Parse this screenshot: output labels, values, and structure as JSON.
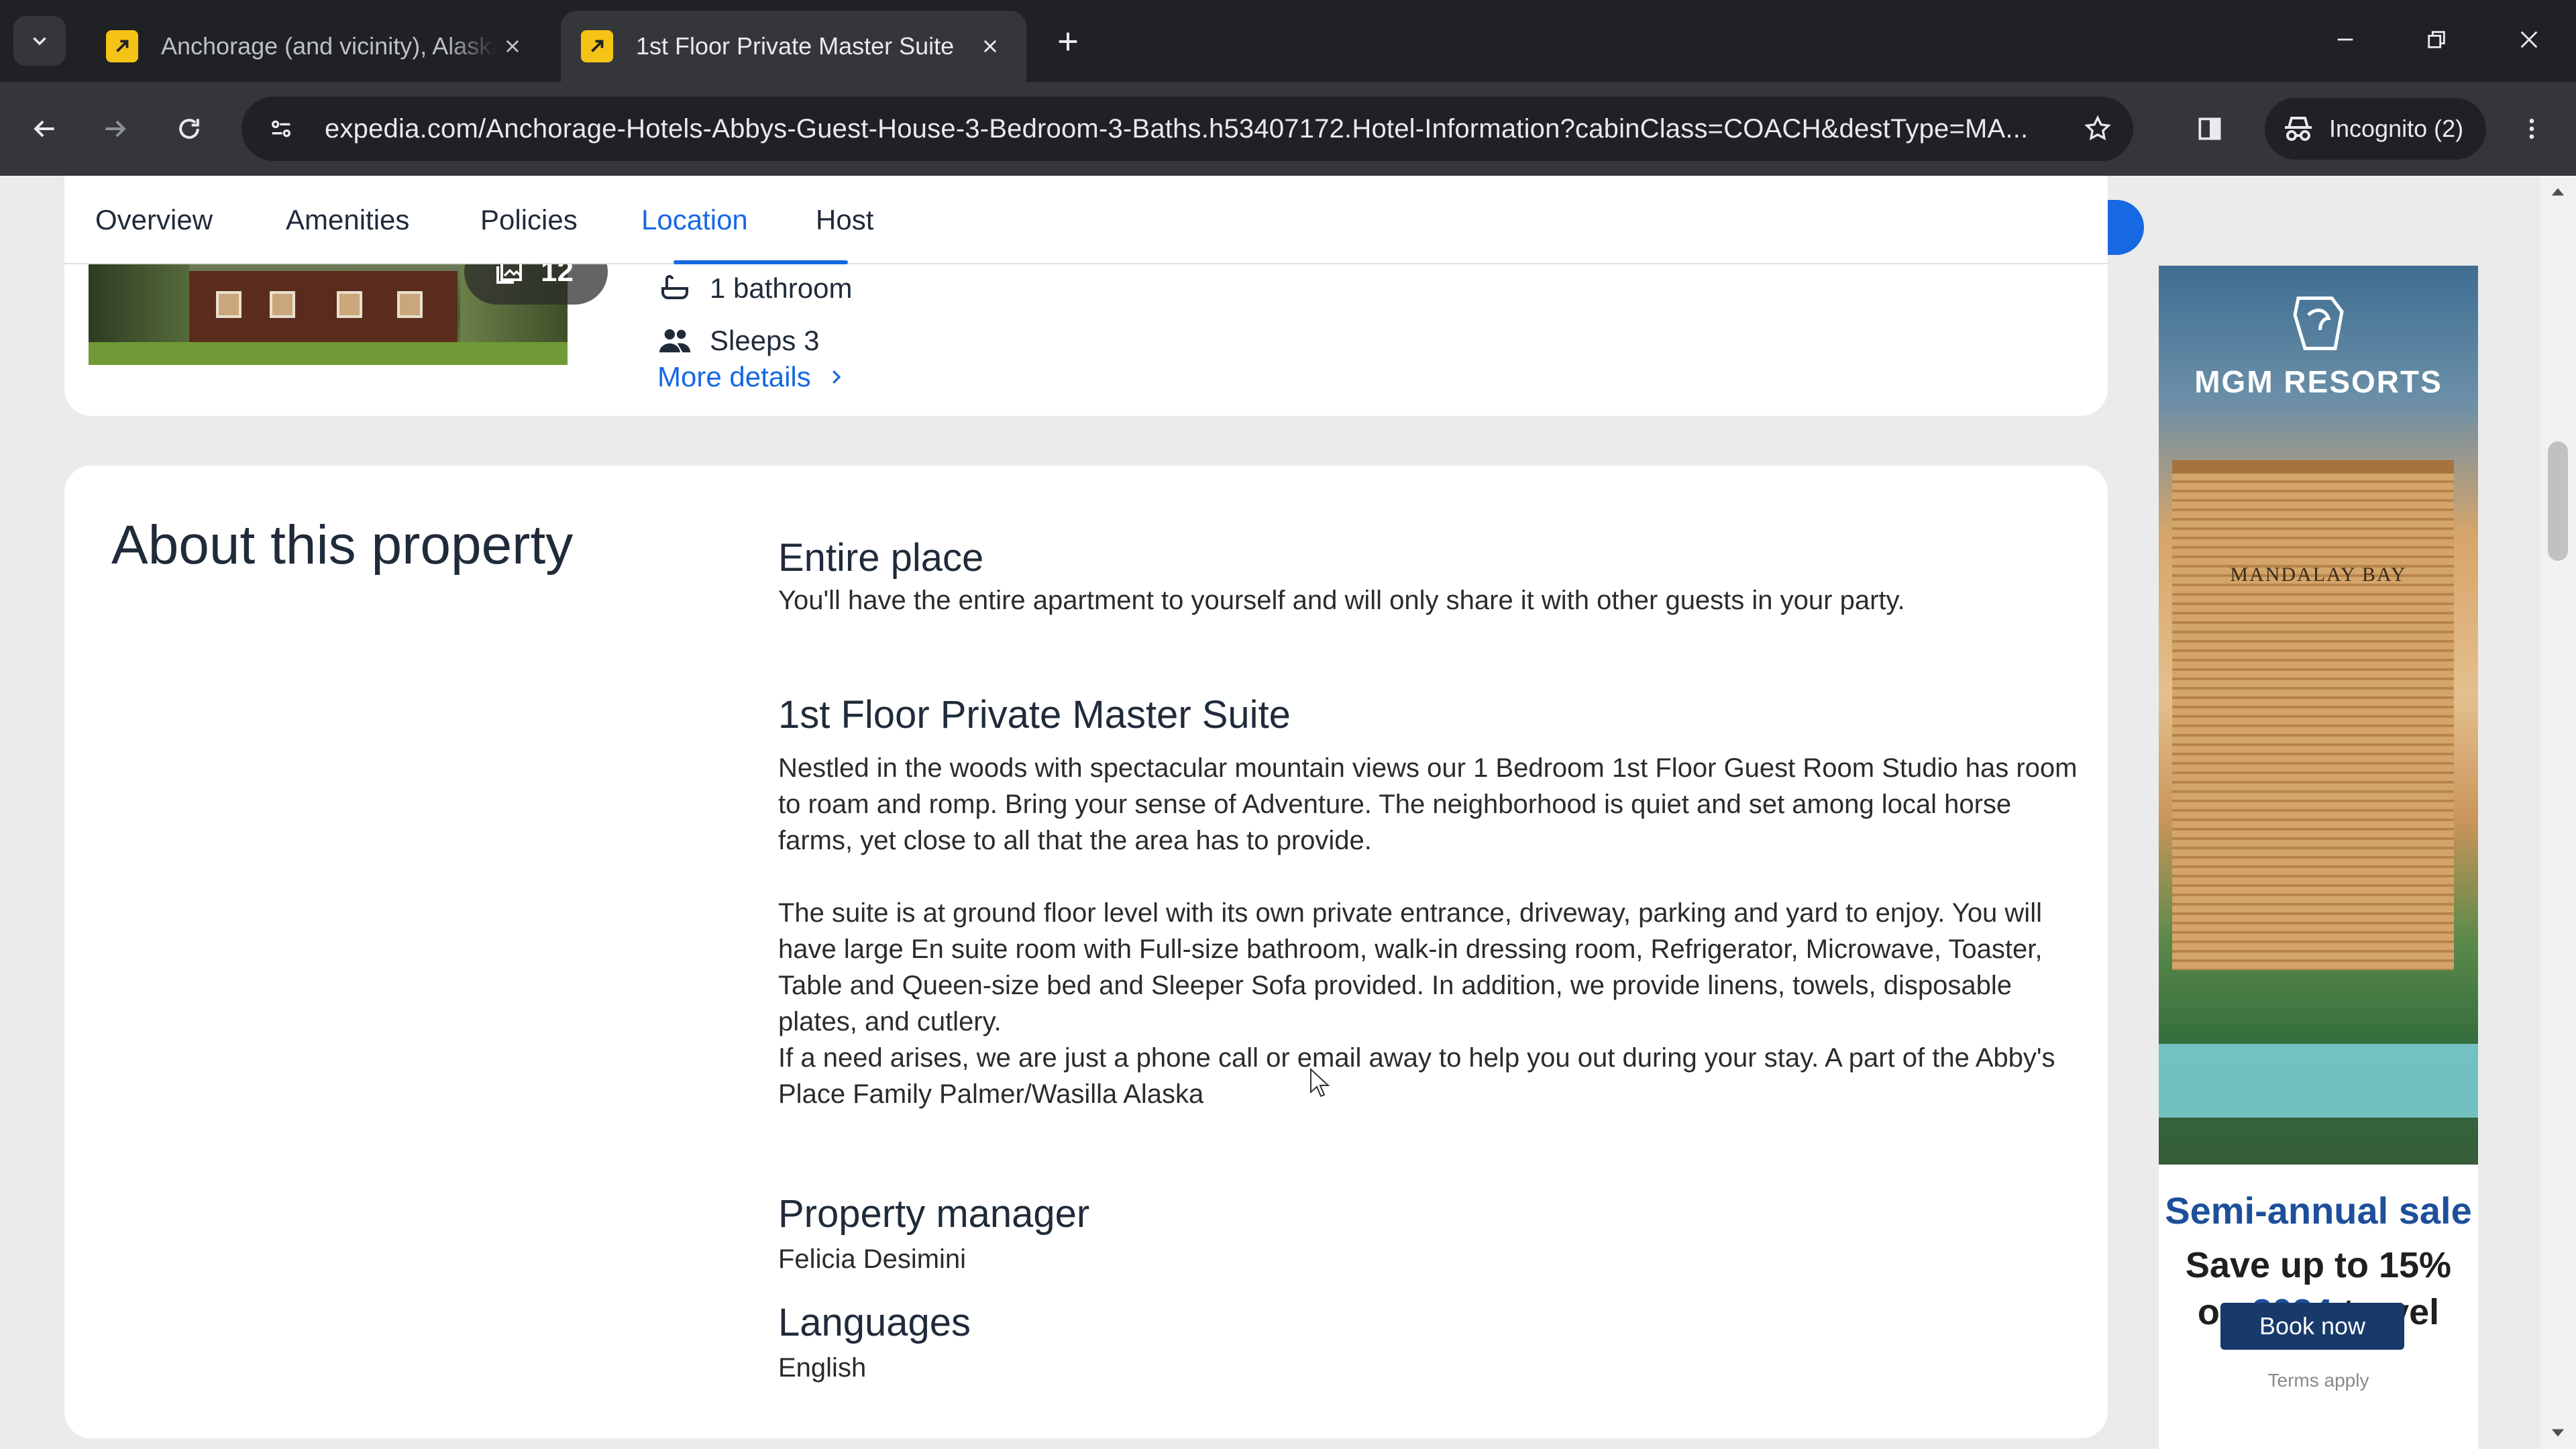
{
  "browser": {
    "tabs": [
      {
        "title": "Anchorage (and vicinity), Alaska",
        "active": false
      },
      {
        "title": "1st Floor Private Master Suite",
        "active": true
      }
    ],
    "url": "expedia.com/Anchorage-Hotels-Abbys-Guest-House-3-Bedroom-3-Baths.h53407172.Hotel-Information?cabinClass=COACH&destType=MA...",
    "incognito_label": "Incognito (2)",
    "accent": "#1668e3"
  },
  "nav": {
    "tabs": [
      {
        "label": "Overview"
      },
      {
        "label": "Amenities"
      },
      {
        "label": "Policies"
      },
      {
        "label": "Location"
      },
      {
        "label": "Host"
      }
    ],
    "active": "Location"
  },
  "summary": {
    "photo_count": "12",
    "features": [
      {
        "icon": "bathtub-icon",
        "label": "1 bathroom"
      },
      {
        "icon": "people-icon",
        "label": "Sleeps 3"
      }
    ],
    "more_details": "More details"
  },
  "about": {
    "title": "About this property",
    "entire_place": {
      "heading": "Entire place",
      "text": "You'll have the entire apartment to yourself and will only share it with other guests in your party."
    },
    "suite": {
      "heading": "1st Floor Private Master Suite",
      "p1": "Nestled in the woods with spectacular mountain views our 1 Bedroom 1st Floor Guest Room Studio has room to roam and romp. Bring your sense of Adventure. The neighborhood is quiet and set among local horse farms, yet close to all that the area has to provide.",
      "p2": "The suite is at ground floor level with its own private entrance, driveway, parking and yard to enjoy. You will have large En suite room with Full-size bathroom, walk-in dressing room, Refrigerator, Microwave, Toaster, Table and Queen-size bed and Sleeper Sofa provided. In addition, we provide linens, towels, disposable plates, and cutlery.",
      "p3": "If a need arises, we are just a phone call or email away to help you out during your stay. A part of the Abby's Place Family Palmer/Wasilla Alaska"
    },
    "manager": {
      "heading": "Property manager",
      "value": "Felicia Desimini"
    },
    "languages": {
      "heading": "Languages",
      "value": "English"
    }
  },
  "ad": {
    "brand": "MGM RESORTS",
    "property": "MANDALAY BAY",
    "headline": "Semi-annual sale",
    "offer_line1": "Save up to 15%",
    "offer_line2_pre": "on ",
    "offer_year": "2024",
    "offer_line2_post": " travel",
    "button": "Book now",
    "terms": "Terms apply"
  }
}
